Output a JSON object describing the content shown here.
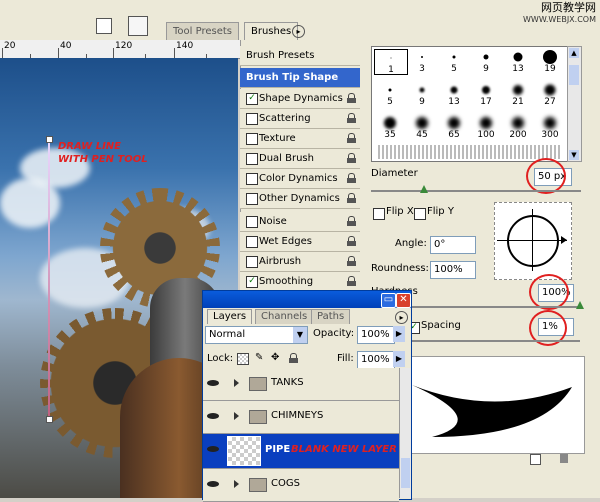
{
  "watermark": {
    "line1": "网页教学网",
    "line2": "WWW.WEBJX.COM"
  },
  "ruler": {
    "marks": [
      "20",
      "40",
      "120",
      "140"
    ]
  },
  "canvas": {
    "annotation_line1": "DRAW LINE",
    "annotation_line2": "WITH PEN TOOL"
  },
  "brushes_panel": {
    "tabs": [
      "Tool Presets",
      "Brushes"
    ],
    "list_items": [
      {
        "label": "Brush Presets",
        "checkbox": false,
        "header": false
      },
      {
        "label": "Brush Tip Shape",
        "checkbox": false,
        "header": true
      },
      {
        "label": "Shape Dynamics",
        "checkbox": true,
        "checked": true
      },
      {
        "label": "Scattering",
        "checkbox": true,
        "checked": false
      },
      {
        "label": "Texture",
        "checkbox": true,
        "checked": false
      },
      {
        "label": "Dual Brush",
        "checkbox": true,
        "checked": false
      },
      {
        "label": "Color Dynamics",
        "checkbox": true,
        "checked": false
      },
      {
        "label": "Other Dynamics",
        "checkbox": true,
        "checked": false
      },
      {
        "label": "Noise",
        "checkbox": true,
        "checked": false
      },
      {
        "label": "Wet Edges",
        "checkbox": true,
        "checked": false
      },
      {
        "label": "Airbrush",
        "checkbox": true,
        "checked": false
      },
      {
        "label": "Smoothing",
        "checkbox": true,
        "checked": true
      }
    ],
    "brush_sizes_row1": [
      "1",
      "3",
      "5",
      "9",
      "13",
      "19"
    ],
    "brush_sizes_row2": [
      "5",
      "9",
      "13",
      "17",
      "21",
      "27"
    ],
    "brush_sizes_row3": [
      "35",
      "45",
      "65",
      "100",
      "200",
      "300"
    ],
    "diameter_label": "Diameter",
    "diameter_value": "50 px",
    "flip_x_label": "Flip X",
    "flip_y_label": "Flip Y",
    "angle_label": "Angle:",
    "angle_value": "0°",
    "roundness_label": "Roundness:",
    "roundness_value": "100%",
    "hardness_label": "Hardness",
    "hardness_value": "100%",
    "spacing_label": "Spacing",
    "spacing_value": "1%",
    "spacing_checked": true
  },
  "layers_panel": {
    "tabs": [
      "Layers",
      "Channels",
      "Paths"
    ],
    "blend_mode": "Normal",
    "opacity_label": "Opacity:",
    "opacity_value": "100%",
    "lock_label": "Lock:",
    "fill_label": "Fill:",
    "fill_value": "100%",
    "layers": [
      {
        "name": "TANKS",
        "type": "folder"
      },
      {
        "name": "CHIMNEYS",
        "type": "folder"
      },
      {
        "name": "PIPE",
        "type": "layer",
        "selected": true,
        "annotation": "BLANK NEW LAYER"
      },
      {
        "name": "COGS",
        "type": "folder"
      }
    ]
  },
  "colors": {
    "accent": "#3366cc",
    "selection": "#0a3fbf",
    "annotation_red": "#e02020"
  }
}
